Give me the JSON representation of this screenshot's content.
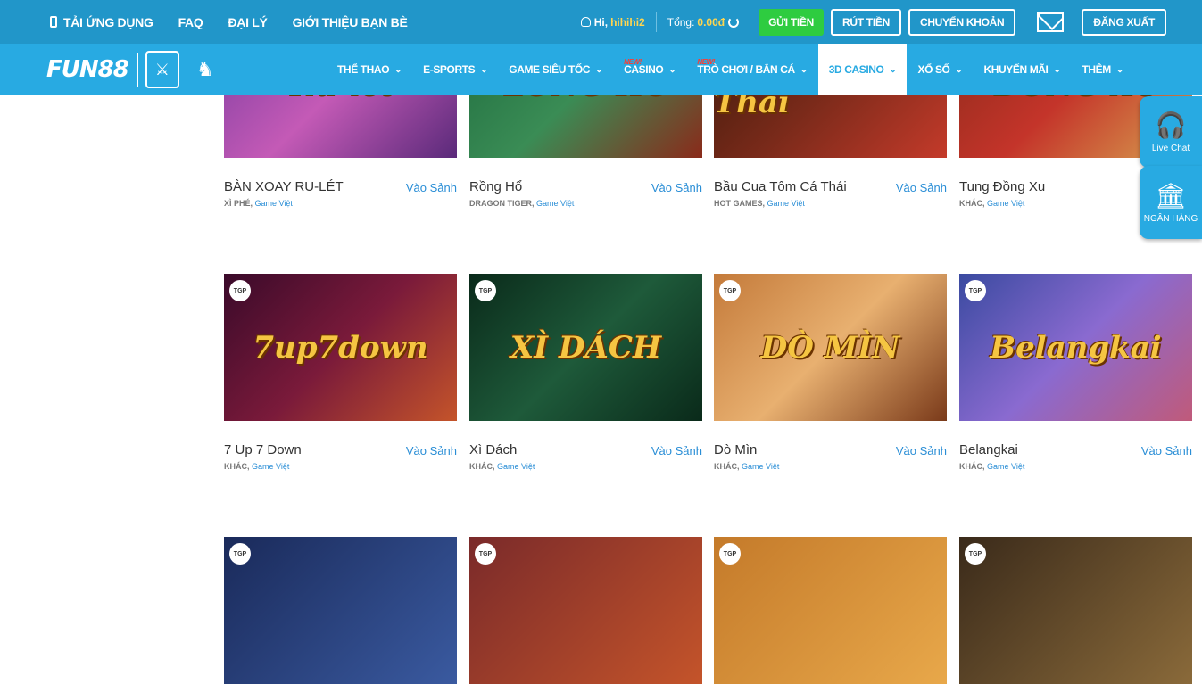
{
  "topbar": {
    "app_label": "TẢI ỨNG DỤNG",
    "faq": "FAQ",
    "agent": "ĐẠI LÝ",
    "refer": "GIỚI THIỆU BẠN BÈ",
    "greeting": "Hi,",
    "username": "hihihi2",
    "balance_label": "Tổng:",
    "balance_value": "0.00đ",
    "deposit": "GỬI TIỀN",
    "withdraw": "RÚT TIỀN",
    "transfer": "CHUYỂN KHOẢN",
    "logout": "ĐĂNG XUẤT"
  },
  "nav": {
    "logo": "FUN88",
    "items": [
      {
        "label": "THỂ THAO"
      },
      {
        "label": "E-SPORTS"
      },
      {
        "label": "GAME SIÊU TỐC"
      },
      {
        "label": "CASINO",
        "badge": "NEW!"
      },
      {
        "label": "TRÒ CHƠI / BẮN CÁ",
        "badge": "NEW!"
      },
      {
        "label": "3D CASINO",
        "active": true
      },
      {
        "label": "XỔ SỐ"
      },
      {
        "label": "KHUYẾN MÃI"
      },
      {
        "label": "THÊM"
      }
    ]
  },
  "side": {
    "chat": "Live Chat",
    "bank": "NGÂN HÀNG"
  },
  "go_label": "Vào Sảnh",
  "tag_provider": "Game Việt",
  "tgp": "TGP",
  "games": [
    {
      "title": "BÀN XOAY RU-LÉT",
      "category": "XÌ PHÉ,",
      "art": "Ru-lét",
      "tgp": false,
      "bg": "linear-gradient(135deg,#7a3ca0,#c45ab6,#5a2a7a)"
    },
    {
      "title": "Rồng Hổ",
      "category": "DRAGON TIGER,",
      "art": "LONG HỔ",
      "tgp": false,
      "bg": "linear-gradient(135deg,#1e6b3e,#3a8c55,#8a2a1a)"
    },
    {
      "title": "Bầu Cua Tôm Cá Thái",
      "category": "HOT GAMES,",
      "art": "Tôm Cua Cá Thái",
      "tgp": false,
      "bg": "linear-gradient(135deg,#3a1a0a,#7a2a1a,#c43a2a)"
    },
    {
      "title": "Tung Đồng Xu",
      "category": "KHÁC,",
      "art": "ĐỒNG XU",
      "tgp": false,
      "bg": "linear-gradient(135deg,#8a2a1a,#c4342a,#d8a050)"
    },
    {
      "title": "7 Up 7 Down",
      "category": "KHÁC,",
      "art": "7up7down",
      "tgp": true,
      "bg": "linear-gradient(135deg,#3a0a2a,#7a1a3a,#c4542a)"
    },
    {
      "title": "Xì Dách",
      "category": "KHÁC,",
      "art": "XÌ DÁCH",
      "tgp": true,
      "bg": "linear-gradient(135deg,#0a2a1a,#1e5a3a,#0a2a1a)"
    },
    {
      "title": "Dò Mìn",
      "category": "KHÁC,",
      "art": "DÒ MÌN",
      "tgp": true,
      "bg": "linear-gradient(135deg,#c47a3a,#e8b070,#7a3a1a)"
    },
    {
      "title": "Belangkai",
      "category": "KHÁC,",
      "art": "Belangkai",
      "tgp": true,
      "bg": "linear-gradient(135deg,#3a4aa0,#8a6ad0,#c05a7a)"
    },
    {
      "title": "",
      "category": "",
      "art": "",
      "tgp": true,
      "bg": "linear-gradient(135deg,#1a2a5a,#3a5aa0)"
    },
    {
      "title": "",
      "category": "",
      "art": "",
      "tgp": true,
      "bg": "linear-gradient(135deg,#7a2a2a,#c4542a)"
    },
    {
      "title": "",
      "category": "",
      "art": "",
      "tgp": true,
      "bg": "linear-gradient(135deg,#c47a2a,#e8a84a)"
    },
    {
      "title": "",
      "category": "",
      "art": "",
      "tgp": true,
      "bg": "linear-gradient(135deg,#3a2a1a,#8a6a3a)"
    }
  ]
}
